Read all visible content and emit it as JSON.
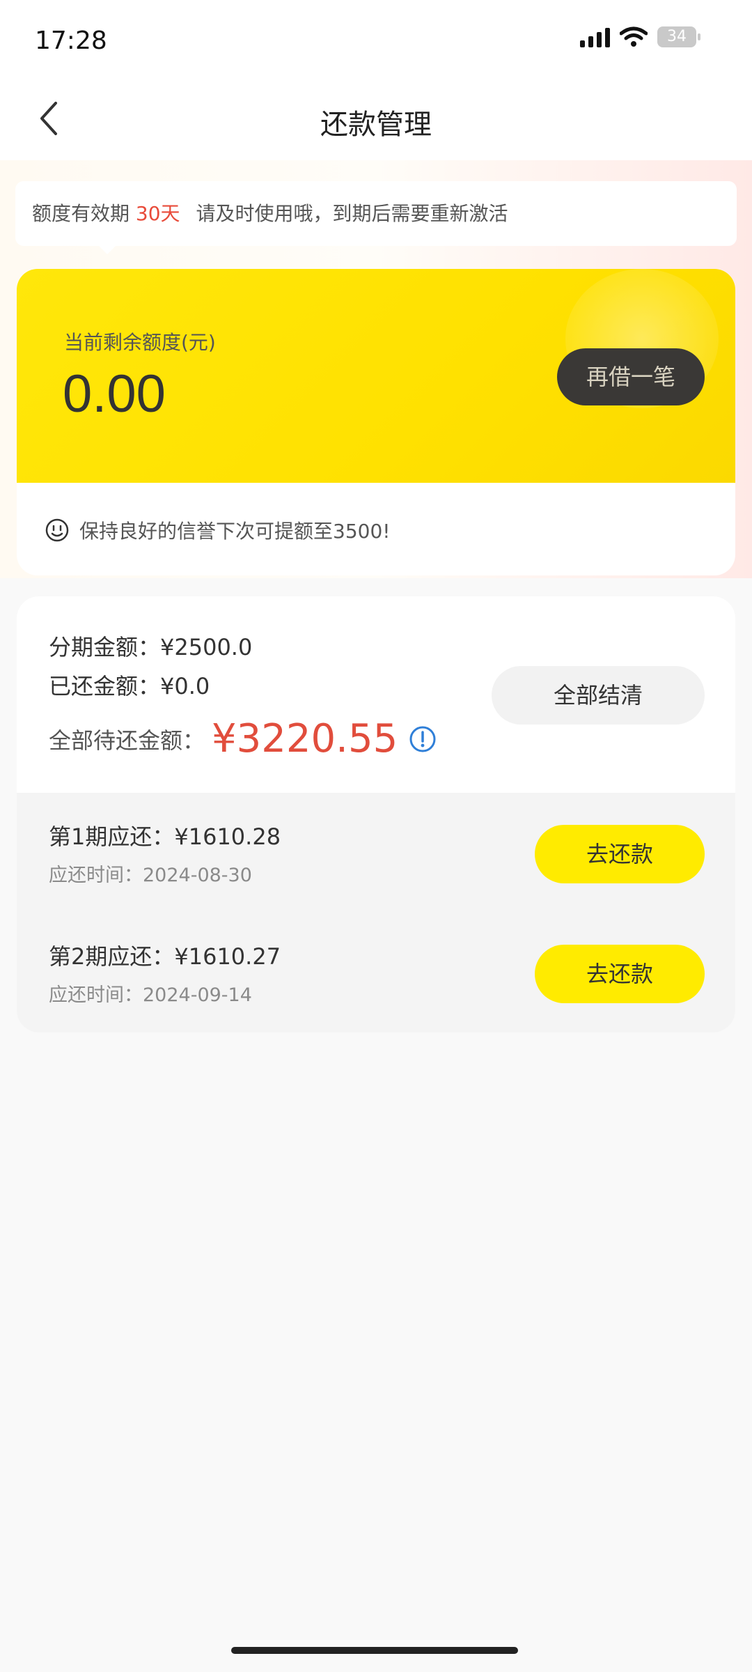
{
  "status_bar": {
    "time": "17:28",
    "battery": "34"
  },
  "header": {
    "title": "还款管理"
  },
  "notice": {
    "prefix": "额度有效期",
    "highlight": "30天",
    "suffix": "请及时使用哦，到期后需要重新激活"
  },
  "credit": {
    "label": "当前剩余额度(元)",
    "amount": "0.00",
    "borrow_again": "再借一笔",
    "tip": "保持良好的信誉下次可提额至3500!"
  },
  "repayment": {
    "installment_amount": "分期金额：¥2500.0",
    "repaid_amount": "已还金额：¥0.0",
    "total_due_label": "全部待还金额：",
    "total_due_value": "¥3220.55",
    "settle_all": "全部结清",
    "installments": [
      {
        "title": "第1期应还：¥1610.28",
        "due_date": "应还时间：2024-08-30",
        "action": "去还款"
      },
      {
        "title": "第2期应还：¥1610.27",
        "due_date": "应还时间：2024-09-14",
        "action": "去还款"
      }
    ]
  },
  "colors": {
    "accent_yellow": "#ffeb00",
    "highlight_red": "#e14d3c",
    "dark_button": "#3a3836"
  },
  "icons": [
    "back-arrow-icon",
    "signal-icon",
    "wifi-icon",
    "battery-icon",
    "smile-icon",
    "info-icon"
  ]
}
